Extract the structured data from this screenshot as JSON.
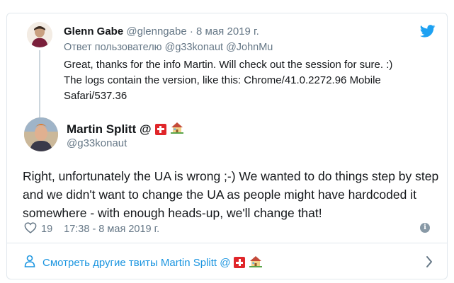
{
  "parent": {
    "name": "Glenn Gabe",
    "handle": "@glenngabe",
    "separator": "·",
    "date": "8 мая 2019 г.",
    "reply_prefix": "Ответ пользователю",
    "reply_mentions": "@g33konaut @JohnMu",
    "text_line1": "Great, thanks for the info Martin. Will check out the session for sure. :)",
    "text_line2": "The logs contain the version, like this: Chrome/41.0.2272.96 Mobile",
    "text_line3": "Safari/537.36"
  },
  "main": {
    "name": "Martin Splitt @",
    "handle": "@g33konaut",
    "text": "Right, unfortunately the UA is wrong ;-) We wanted to do things step by step and we didn't want to change the UA as people might have hardcoded it somewhere - with enough heads-up, we'll change that!",
    "likes": "19",
    "time": "17:38 - 8 мая 2019 г."
  },
  "footer": {
    "more_label": "Смотреть другие твиты Martin Splitt @"
  },
  "colors": {
    "link": "#1b95e0",
    "muted": "#657786",
    "twitter_blue": "#1da1f2",
    "swiss_red": "#e0262a"
  },
  "icons": [
    "twitter-bird-icon",
    "swiss-flag-icon",
    "house-icon",
    "heart-icon",
    "info-icon",
    "person-icon",
    "chevron-right-icon"
  ]
}
